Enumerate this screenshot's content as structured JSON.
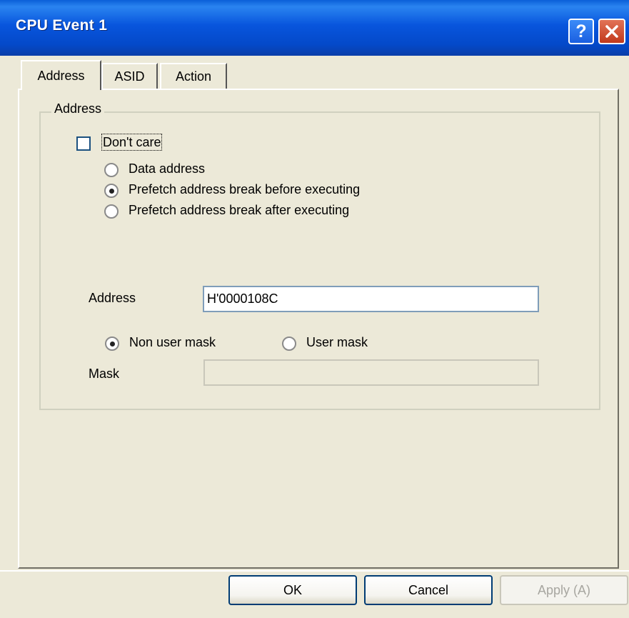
{
  "window": {
    "title": "CPU Event 1"
  },
  "titlebar": {
    "help_glyph": "?",
    "close_glyph": "✕"
  },
  "tabs": [
    {
      "label": "Address",
      "active": true
    },
    {
      "label": "ASID",
      "active": false
    },
    {
      "label": "Action",
      "active": false
    }
  ],
  "address_group": {
    "legend": "Address",
    "dont_care": {
      "label": "Don't care",
      "checked": false
    },
    "address_type": [
      {
        "label": "Data address",
        "selected": false
      },
      {
        "label": "Prefetch address break before executing",
        "selected": true
      },
      {
        "label": "Prefetch address break after executing",
        "selected": false
      }
    ],
    "address_field": {
      "label": "Address",
      "value": "H'0000108C"
    },
    "mask_mode": [
      {
        "label": "Non user mask",
        "selected": true
      },
      {
        "label": "User mask",
        "selected": false
      }
    ],
    "mask_field": {
      "label": "Mask",
      "value": ""
    }
  },
  "buttons": {
    "ok": "OK",
    "cancel": "Cancel",
    "apply": "Apply (A)"
  },
  "colors": {
    "titlebar": "#0855dd",
    "close_button": "#c1391c",
    "dialog_bg": "#ece9d8"
  }
}
